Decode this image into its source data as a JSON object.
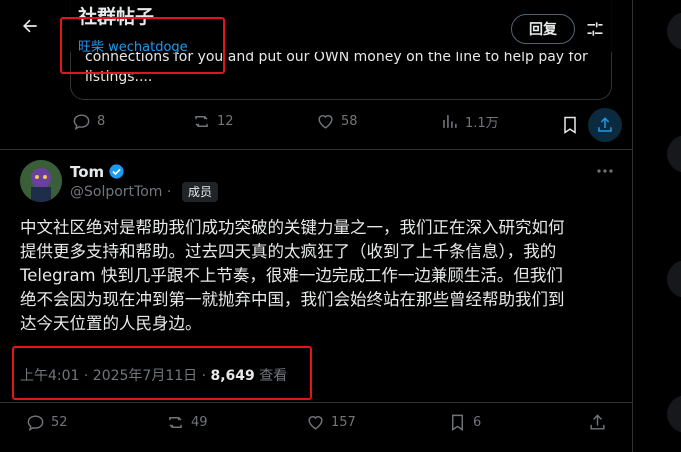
{
  "header": {
    "title": "社群帖子",
    "subtitle": "旺柴 wechatdoge",
    "reply_label": "回复"
  },
  "quoted": {
    "line1": "connections for you and put our OWN money on the line to help pay for",
    "line2": "listings...."
  },
  "top_actions": {
    "replies": "8",
    "retweets": "12",
    "likes": "58",
    "views": "1.1万"
  },
  "tweet": {
    "name": "Tom",
    "handle": "@SolportTom",
    "separator": "·",
    "badge": "成员",
    "lines": [
      "中文社区绝对是帮助我们成功突破的关键力量之一，我们正在深入研究如何",
      "提供更多支持和帮助。过去四天真的太疯狂了（收到了上千条信息），我的",
      "Telegram 快到几乎跟不上节奏，很难一边完成工作一边兼顾生活。但我们",
      "绝不会因为现在冲到第一就抛弃中国，我们会始终站在那些曾经帮助我们到",
      "达今天位置的人民身边。"
    ],
    "time": "上午4:01 · 2025年7月11日 ·",
    "views_count": "8,649",
    "views_label": "查看"
  },
  "bottom_actions": {
    "replies": "52",
    "retweets": "49",
    "likes": "157",
    "bookmarks": "6"
  },
  "colors": {
    "accent": "#1d9bf0",
    "highlight_box": "#e0161b",
    "muted": "#71767b"
  }
}
